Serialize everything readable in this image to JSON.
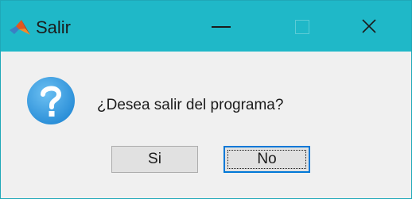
{
  "window": {
    "title": "Salir",
    "app_icon": "matlab-icon",
    "titlebar_color": "#1fb8c8"
  },
  "titlebar_buttons": {
    "minimize_icon": "minimize-icon",
    "maximize_icon": "maximize-icon",
    "close_icon": "close-icon"
  },
  "dialog": {
    "icon": "question-icon",
    "icon_color": "#2b8fd8",
    "message": "¿Desea salir del programa?",
    "buttons": {
      "yes_label": "Si",
      "no_label": "No"
    },
    "focus_color": "#0078d7"
  }
}
